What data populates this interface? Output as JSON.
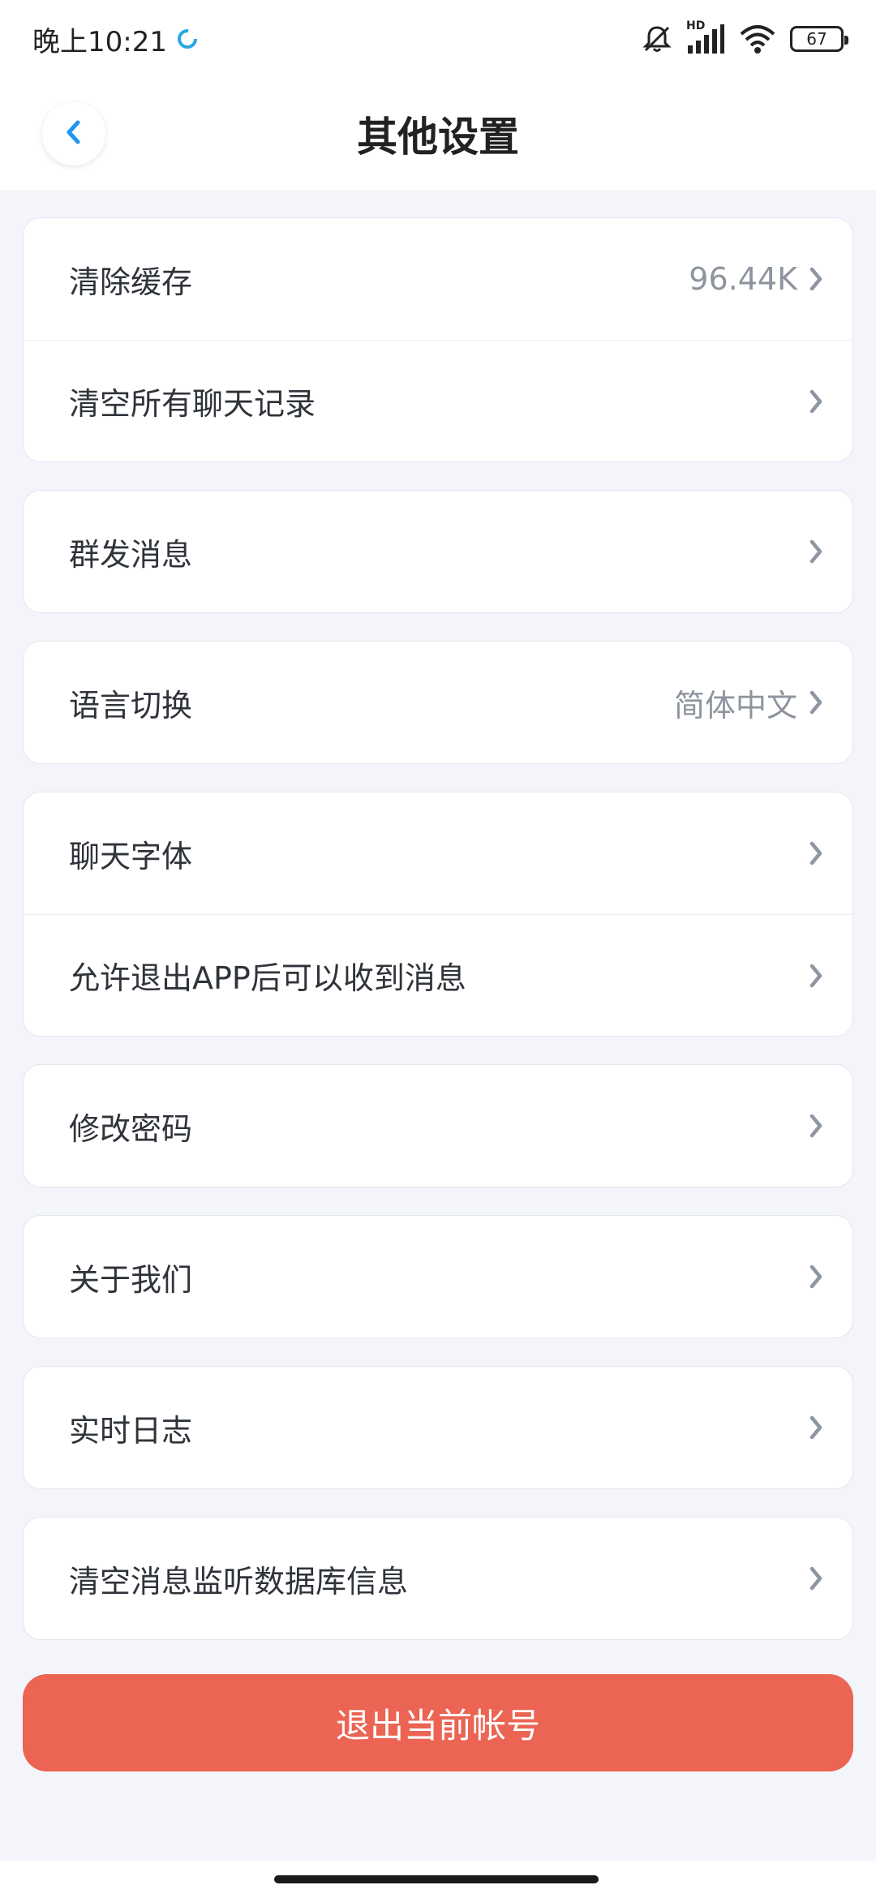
{
  "status_bar": {
    "time": "晚上10:21",
    "hd_label": "HD",
    "battery": "67"
  },
  "header": {
    "title": "其他设置"
  },
  "settings_groups": [
    {
      "rows": [
        {
          "label": "清除缓存",
          "value": "96.44K"
        },
        {
          "label": "清空所有聊天记录",
          "value": ""
        }
      ]
    },
    {
      "rows": [
        {
          "label": "群发消息",
          "value": ""
        }
      ]
    },
    {
      "rows": [
        {
          "label": "语言切换",
          "value": "简体中文"
        }
      ]
    },
    {
      "rows": [
        {
          "label": "聊天字体",
          "value": ""
        },
        {
          "label": "允许退出APP后可以收到消息",
          "value": ""
        }
      ]
    },
    {
      "rows": [
        {
          "label": "修改密码",
          "value": ""
        }
      ]
    },
    {
      "rows": [
        {
          "label": "关于我们",
          "value": ""
        }
      ]
    },
    {
      "rows": [
        {
          "label": "实时日志",
          "value": ""
        }
      ]
    },
    {
      "rows": [
        {
          "label": "清空消息监听数据库信息",
          "value": ""
        }
      ]
    }
  ],
  "logout": {
    "label": "退出当前帐号"
  },
  "colors": {
    "accent_blue": "#2196f3",
    "logout_red": "#ec6453",
    "chevron": "#8f96a3"
  }
}
